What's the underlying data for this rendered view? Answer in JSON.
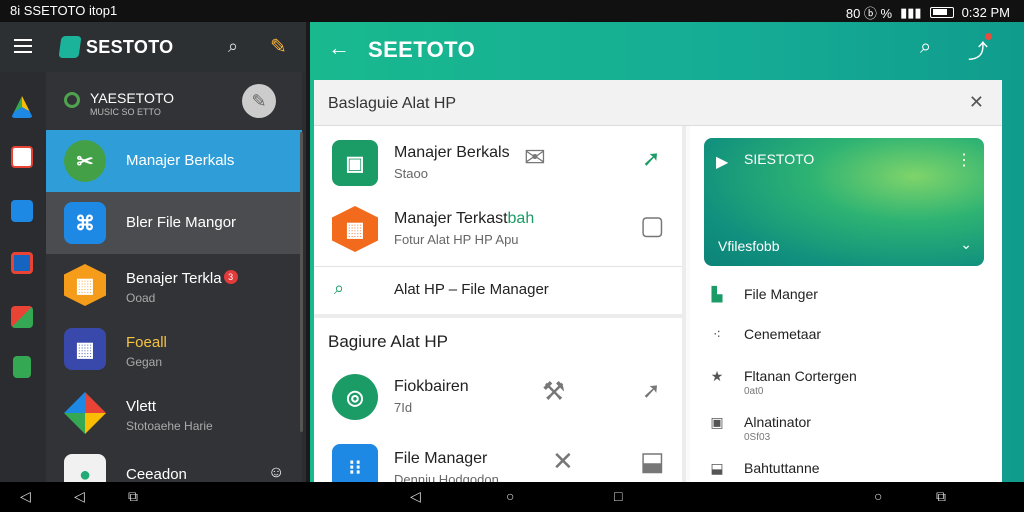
{
  "statusbar": {
    "left_text": "8i  SSETOTO itop1",
    "right_text": "80  ⓑ  %",
    "time": "0:32 PM"
  },
  "left_app": {
    "title": "SESTOTO",
    "account": {
      "name": "YAESETOTO",
      "sub": "MUSIC SO ETTO"
    },
    "items": [
      {
        "label": "Manajer Berkals",
        "sub": ""
      },
      {
        "label": "Bler File Mangor",
        "sub": ""
      },
      {
        "label": "Benajer Terkla",
        "sub": "Ooad",
        "badge": "3"
      },
      {
        "label": "Foeall",
        "sub": "Gegan"
      },
      {
        "label": "Vlett",
        "sub": "Stotoaehe Harie"
      },
      {
        "label": "Ceeadon",
        "sub": ""
      }
    ]
  },
  "right_app": {
    "title": "SEETOTO",
    "dialog": {
      "title": "Baslaguie Alat HP",
      "rows": [
        {
          "title": "Manajer Berkals",
          "sub": "Staoo"
        },
        {
          "title": "Manajer Terkast",
          "title_accent": "bah",
          "sub": "Fotur Alat HP HP Apu"
        }
      ],
      "search_row": "Alat HP – File Manager",
      "section_title": "Bagiure Alat HP",
      "apps": [
        {
          "title": "Fiokbairen",
          "sub": "7Id"
        },
        {
          "title": "File Manager",
          "sub": "Denniu Hodgodon"
        }
      ]
    },
    "card": {
      "title": "SIESTOTO",
      "footer": "Vfilesfobb"
    },
    "side_items": [
      {
        "label": "File Manger",
        "sub": ""
      },
      {
        "label": "Cenemetaar",
        "sub": ""
      },
      {
        "label": "Fltanan Cortergen",
        "sub": "0at0"
      },
      {
        "label": "Alnatinator",
        "sub": "0Sf03"
      },
      {
        "label": "Bahtuttanne",
        "sub": ""
      }
    ]
  },
  "colors": {
    "accent": "#15ac95",
    "selected": "#2f9ed8",
    "dark": "#2b2d30"
  }
}
